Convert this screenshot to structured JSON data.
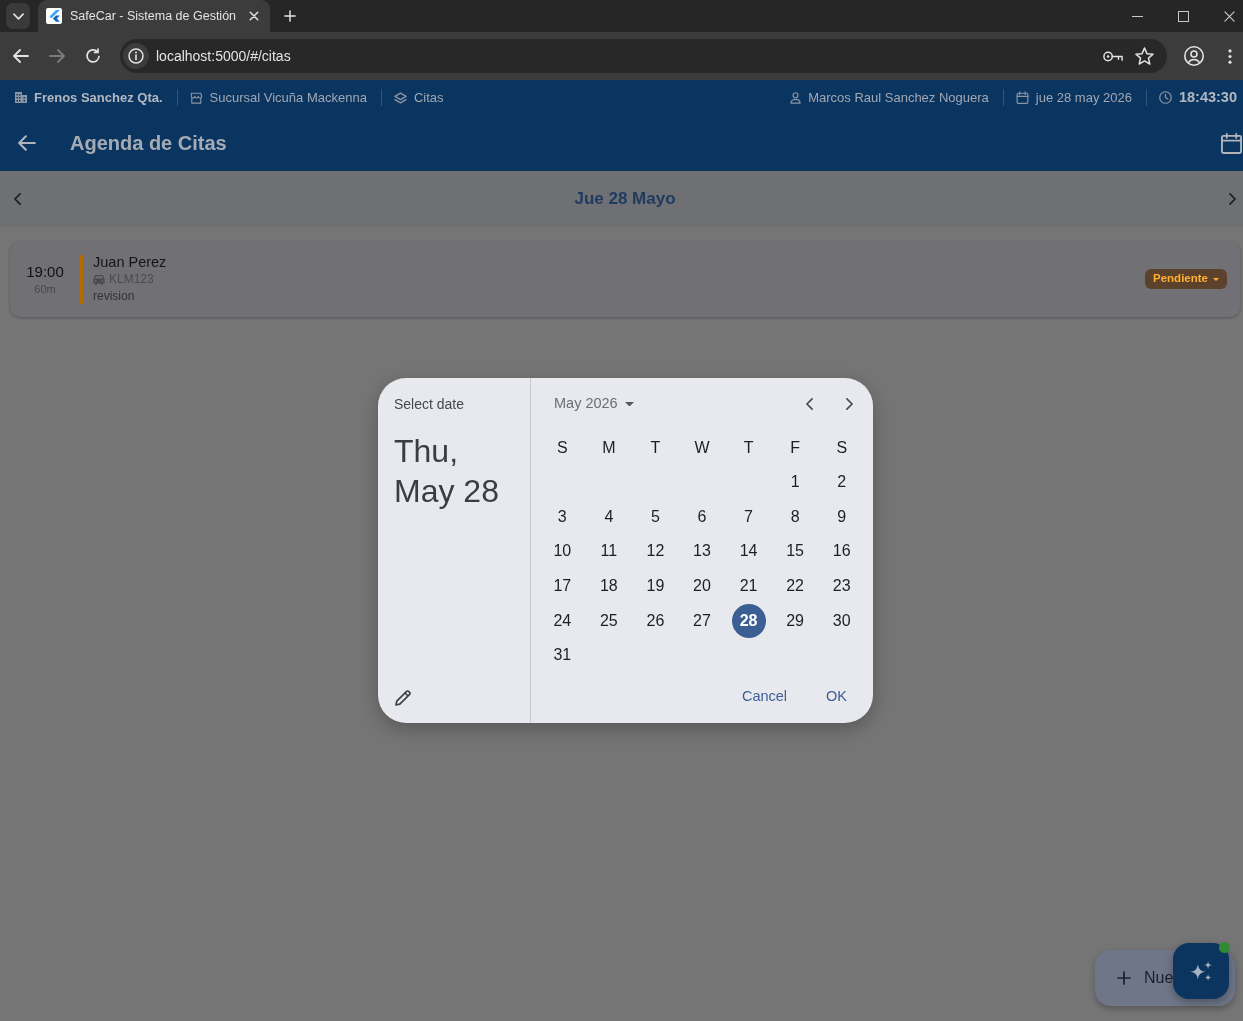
{
  "browser": {
    "tab_title": "SafeCar - Sistema de Gestión",
    "url": "localhost:5000/#/citas",
    "nav_buttons": [
      {
        "kind": "back",
        "disabled": false
      },
      {
        "kind": "forward",
        "disabled": true
      },
      {
        "kind": "reload",
        "disabled": false
      }
    ]
  },
  "info_bar": {
    "left": [
      {
        "kind": "company",
        "text": "Frenos Sanchez Qta."
      },
      {
        "kind": "branch",
        "text": "Sucursal Vicuña Mackenna"
      },
      {
        "kind": "module",
        "text": "Citas"
      }
    ],
    "right": [
      {
        "kind": "user",
        "text": "Marcos Raul Sanchez Noguera"
      },
      {
        "kind": "date",
        "text": "jue 28 may 2026"
      },
      {
        "kind": "clock",
        "text": "18:43:30"
      }
    ]
  },
  "app_bar": {
    "title": "Agenda de Citas"
  },
  "date_nav": {
    "label": "Jue 28 Mayo"
  },
  "appointments": [
    {
      "time": "19:00",
      "duration": "60m",
      "client": "Juan Perez",
      "plate": "KLM123",
      "service": "revision",
      "status": "Pendiente",
      "color": "#b36b00"
    }
  ],
  "fab": {
    "label": "Nue"
  },
  "ai_button": {
    "indicator": true
  },
  "date_picker": {
    "header": "Select date",
    "headline": "Thu, May 28",
    "month": "May 2026",
    "weekdays": [
      "S",
      "M",
      "T",
      "W",
      "T",
      "F",
      "S"
    ],
    "weeks": [
      {
        "days": [
          {
            "label": "1",
            "selected": false
          },
          {
            "label": "2",
            "selected": false
          }
        ]
      },
      {
        "days": [
          {
            "label": "3",
            "selected": false
          },
          {
            "label": "4",
            "selected": false
          },
          {
            "label": "5",
            "selected": false
          },
          {
            "label": "6",
            "selected": false
          },
          {
            "label": "7",
            "selected": false
          },
          {
            "label": "8",
            "selected": false
          },
          {
            "label": "9",
            "selected": false
          }
        ]
      },
      {
        "days": [
          {
            "label": "10",
            "selected": false
          },
          {
            "label": "11",
            "selected": false
          },
          {
            "label": "12",
            "selected": false
          },
          {
            "label": "13",
            "selected": false
          },
          {
            "label": "14",
            "selected": false
          },
          {
            "label": "15",
            "selected": false
          },
          {
            "label": "16",
            "selected": false
          }
        ]
      },
      {
        "days": [
          {
            "label": "17",
            "selected": false
          },
          {
            "label": "18",
            "selected": false
          },
          {
            "label": "19",
            "selected": false
          },
          {
            "label": "20",
            "selected": false
          },
          {
            "label": "21",
            "selected": false
          },
          {
            "label": "22",
            "selected": false
          },
          {
            "label": "23",
            "selected": false
          }
        ]
      },
      {
        "days": [
          {
            "label": "24",
            "selected": false
          },
          {
            "label": "25",
            "selected": false
          },
          {
            "label": "26",
            "selected": false
          },
          {
            "label": "27",
            "selected": false
          },
          {
            "label": "28",
            "selected": true
          },
          {
            "label": "29",
            "selected": false
          },
          {
            "label": "30",
            "selected": false
          }
        ]
      },
      {
        "days": [
          {
            "label": "31",
            "selected": false
          }
        ]
      }
    ],
    "actions": [
      {
        "label": "Cancel"
      },
      {
        "label": "OK"
      }
    ]
  }
}
